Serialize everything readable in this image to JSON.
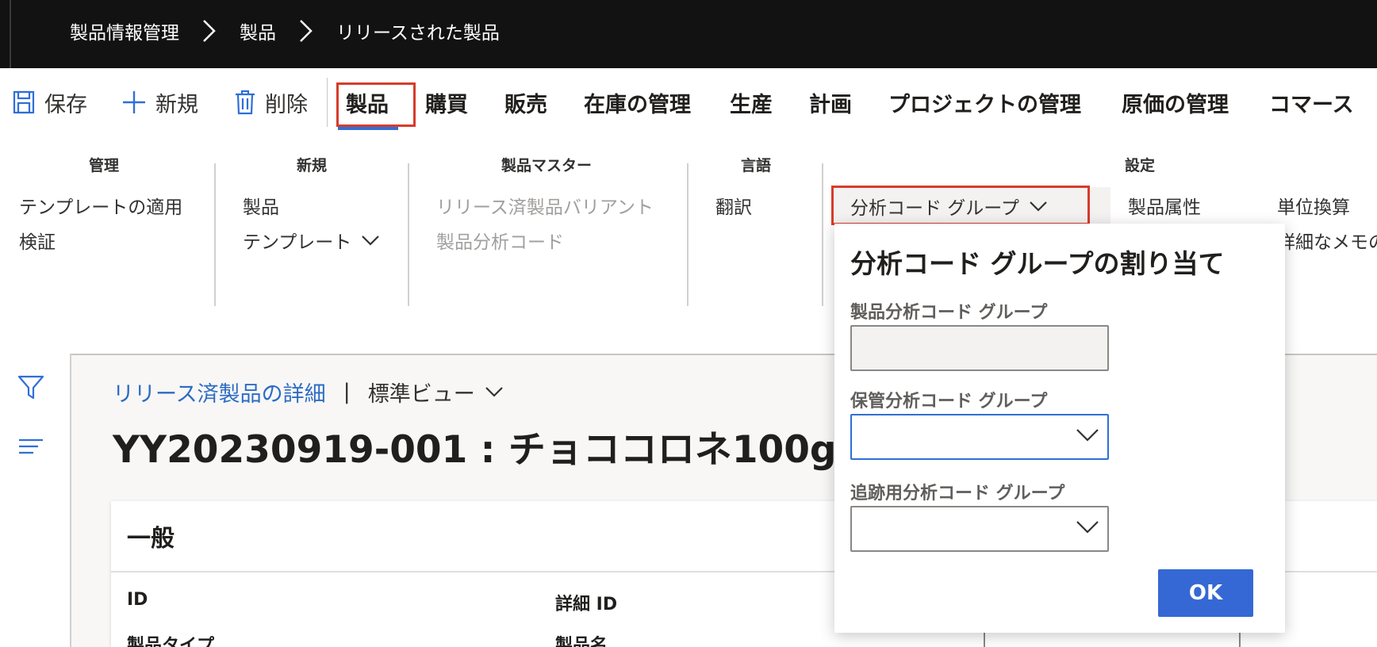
{
  "breadcrumb": {
    "items": [
      "製品情報管理",
      "製品",
      "リリースされた製品"
    ]
  },
  "actions": {
    "save": "保存",
    "new": "新規",
    "delete": "削除"
  },
  "tabs": [
    "製品",
    "購買",
    "販売",
    "在庫の管理",
    "生産",
    "計画",
    "プロジェクトの管理",
    "原価の管理",
    "コマース"
  ],
  "ribbon": {
    "manage": {
      "header": "管理",
      "items": [
        "テンプレートの適用",
        "検証"
      ]
    },
    "new": {
      "header": "新規",
      "items": [
        "製品",
        "テンプレート"
      ]
    },
    "product_master": {
      "header": "製品マスター",
      "items": [
        "リリース済製品バリアント",
        "製品分析コード"
      ]
    },
    "language": {
      "header": "言語",
      "items": [
        "翻訳"
      ]
    },
    "dimension_group_button": "分析コード グループ",
    "settings": {
      "header": "設定",
      "items": [
        "製品属性",
        "単位換算",
        "詳細なメモの"
      ]
    }
  },
  "content": {
    "view_link": "リリース済製品の詳細",
    "separator": "|",
    "view_name": "標準ビュー",
    "title": "YY20230919-001 : チョココロネ100g",
    "card": {
      "header": "一般",
      "labels": [
        "ID",
        "詳細 ID",
        "製品タイプ",
        "製品名"
      ]
    }
  },
  "flyout": {
    "title": "分析コード グループの割り当て",
    "fields": [
      {
        "label": "製品分析コード グループ",
        "value": ""
      },
      {
        "label": "保管分析コード グループ",
        "value": ""
      },
      {
        "label": "追跡用分析コード グループ",
        "value": ""
      }
    ],
    "ok": "OK"
  },
  "colors": {
    "accent": "#2f6fd6",
    "highlight": "#d83b2b",
    "topbar": "#121212",
    "link": "#2b6cc4"
  }
}
